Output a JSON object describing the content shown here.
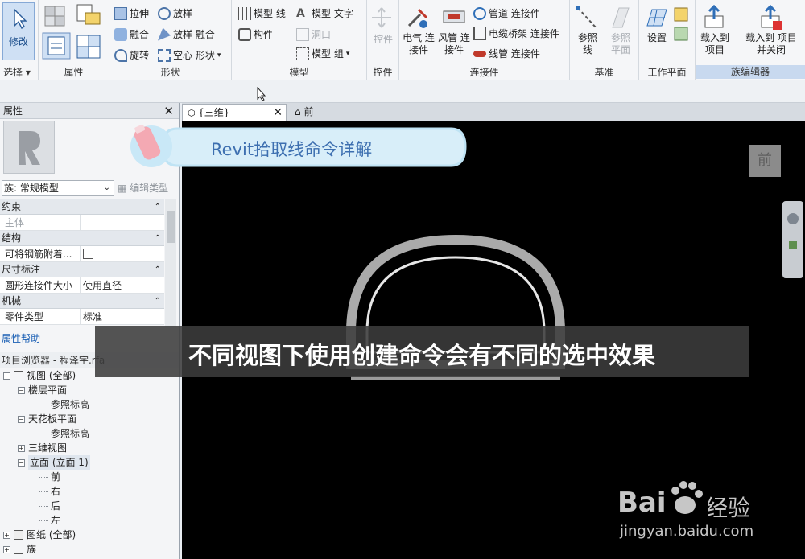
{
  "ribbon": {
    "select": {
      "modify": "修改",
      "menu": "选择 ▾"
    },
    "properties": {
      "title": "属性"
    },
    "forms": {
      "title": "形状",
      "items": [
        "拉伸",
        "放样",
        "融合",
        "放样 融合",
        "旋转",
        "空心 形状"
      ]
    },
    "model": {
      "title": "模型",
      "items": [
        "模型 线",
        "模型 文字",
        "构件",
        "洞口",
        "模型 组"
      ]
    },
    "control": {
      "title": "控件",
      "label": "控件"
    },
    "connectors": {
      "title": "连接件",
      "electrical": "电气 连接件",
      "duct": "风管 连接件",
      "items": [
        "管道 连接件",
        "电缆桥架 连接件",
        "线管 连接件"
      ]
    },
    "datum": {
      "title": "基准",
      "ref_line": "参照 线",
      "ref_plane": "参照 平面"
    },
    "workplane": {
      "title": "工作平面",
      "set": "设置"
    },
    "family_editor": {
      "title": "族编辑器",
      "load": "载入到 项目",
      "load_close": "载入到 项目并关闭"
    }
  },
  "properties_panel": {
    "title": "属性",
    "type_select": "族: 常规模型",
    "edit_type": "编辑类型",
    "rows": [
      {
        "cat": "约束"
      },
      {
        "k": "主体",
        "v": "",
        "grey": true
      },
      {
        "cat": "结构"
      },
      {
        "k": "可将钢筋附着...",
        "v": "",
        "check": true
      },
      {
        "cat": "尺寸标注"
      },
      {
        "k": "圆形连接件大小",
        "v": "使用直径"
      },
      {
        "cat": "机械"
      },
      {
        "k": "零件类型",
        "v": "标准"
      }
    ],
    "help": "属性帮助"
  },
  "project_browser": {
    "title": "项目浏览器 - 程泽宇.rfa",
    "nodes": [
      {
        "label": "视图 (全部)",
        "depth": 0,
        "box": "−"
      },
      {
        "label": "楼层平面",
        "depth": 1,
        "box": "−"
      },
      {
        "label": "参照标高",
        "depth": 2
      },
      {
        "label": "天花板平面",
        "depth": 1,
        "box": "−"
      },
      {
        "label": "参照标高",
        "depth": 2
      },
      {
        "label": "三维视图",
        "depth": 1,
        "box": "+"
      },
      {
        "label": "立面 (立面 1)",
        "depth": 1,
        "box": "−"
      },
      {
        "label": "前",
        "depth": 2
      },
      {
        "label": "右",
        "depth": 2
      },
      {
        "label": "后",
        "depth": 2
      },
      {
        "label": "左",
        "depth": 2
      },
      {
        "label": "图纸 (全部)",
        "depth": 0,
        "box": "+"
      },
      {
        "label": "族",
        "depth": 0,
        "box": "+"
      }
    ]
  },
  "view_tabs": {
    "active": "{三维}",
    "other": "前"
  },
  "nav_cube_label": "前",
  "overlay": {
    "banner": "Revit拾取线命令详解",
    "subtitle": "不同视图下使用创建命令会有不同的选中效果",
    "watermark_url": "jingyan.baidu.com",
    "watermark_brand": "Bai经验"
  }
}
